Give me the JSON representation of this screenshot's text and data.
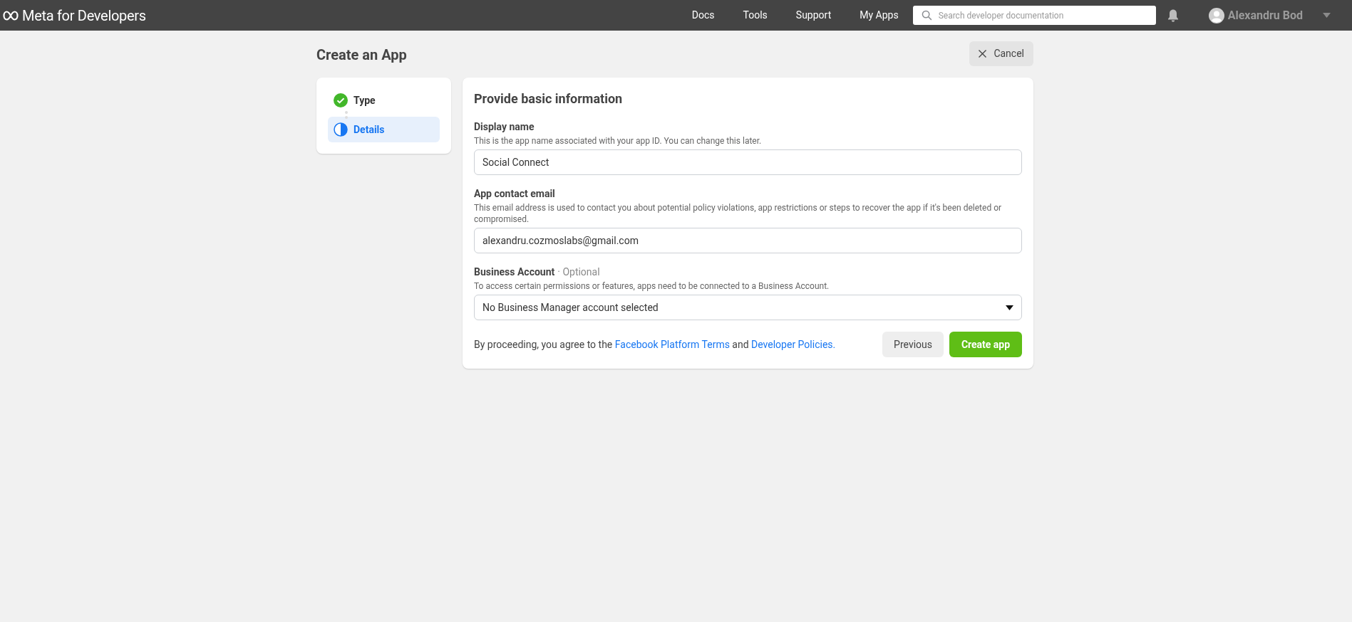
{
  "topbar": {
    "logo": "Meta for Developers",
    "nav": [
      "Docs",
      "Tools",
      "Support",
      "My Apps"
    ],
    "search": {
      "placeholder": "Search developer documentation"
    },
    "user": {
      "name": "Alexandru Bod"
    }
  },
  "page": {
    "title": "Create an App",
    "cancel": "Cancel"
  },
  "steps": [
    {
      "label": "Type",
      "kind": "done",
      "selected": false
    },
    {
      "label": "Details",
      "kind": "current",
      "selected": true
    }
  ],
  "form": {
    "title": "Provide basic information",
    "fields": [
      {
        "kind": "text",
        "label": "Display name",
        "help": "This is the app name associated with your app ID. You can change this later.",
        "value": "Social Connect"
      },
      {
        "kind": "text",
        "label": "App contact email",
        "help": "This email address is used to contact you about potential policy violations, app restrictions or steps to recover the app if it's been deleted or compromised.",
        "value": "alexandru.cozmoslabs@gmail.com"
      },
      {
        "kind": "select",
        "label": "Business Account",
        "optional": "· Optional",
        "help": "To access certain permissions or features, apps need to be connected to a Business Account.",
        "value": "No Business Manager account selected"
      }
    ],
    "agreement": [
      {
        "kind": "text",
        "text": "By proceeding, you agree to the "
      },
      {
        "kind": "link",
        "text": "Facebook Platform Terms"
      },
      {
        "kind": "text",
        "text": " and "
      },
      {
        "kind": "link",
        "text": "Developer Policies."
      }
    ],
    "previous": "Previous",
    "submit": "Create app"
  }
}
